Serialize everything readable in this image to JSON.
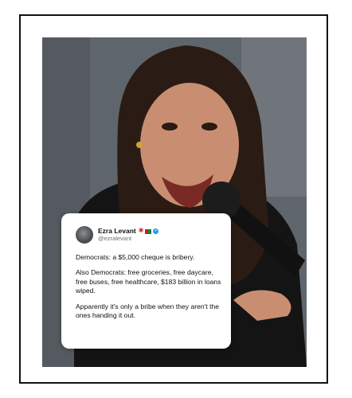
{
  "tweet": {
    "display_name": "Ezra Levant",
    "handle": "@ezralevant",
    "paragraphs": [
      "Democrats: a $5,000 cheque is bribery.",
      "Also Democrats: free groceries, free daycare, free buses, free healthcare, $183 billion in loans wiped.",
      "Apparently it's only a bribe when they aren't the ones handing it out."
    ],
    "badges": [
      "maple-leaf-icon",
      "flag-icon",
      "verified-icon"
    ]
  },
  "colors": {
    "verified": "#1d9bf0",
    "frame_border": "#111111",
    "card_background": "#ffffff"
  }
}
